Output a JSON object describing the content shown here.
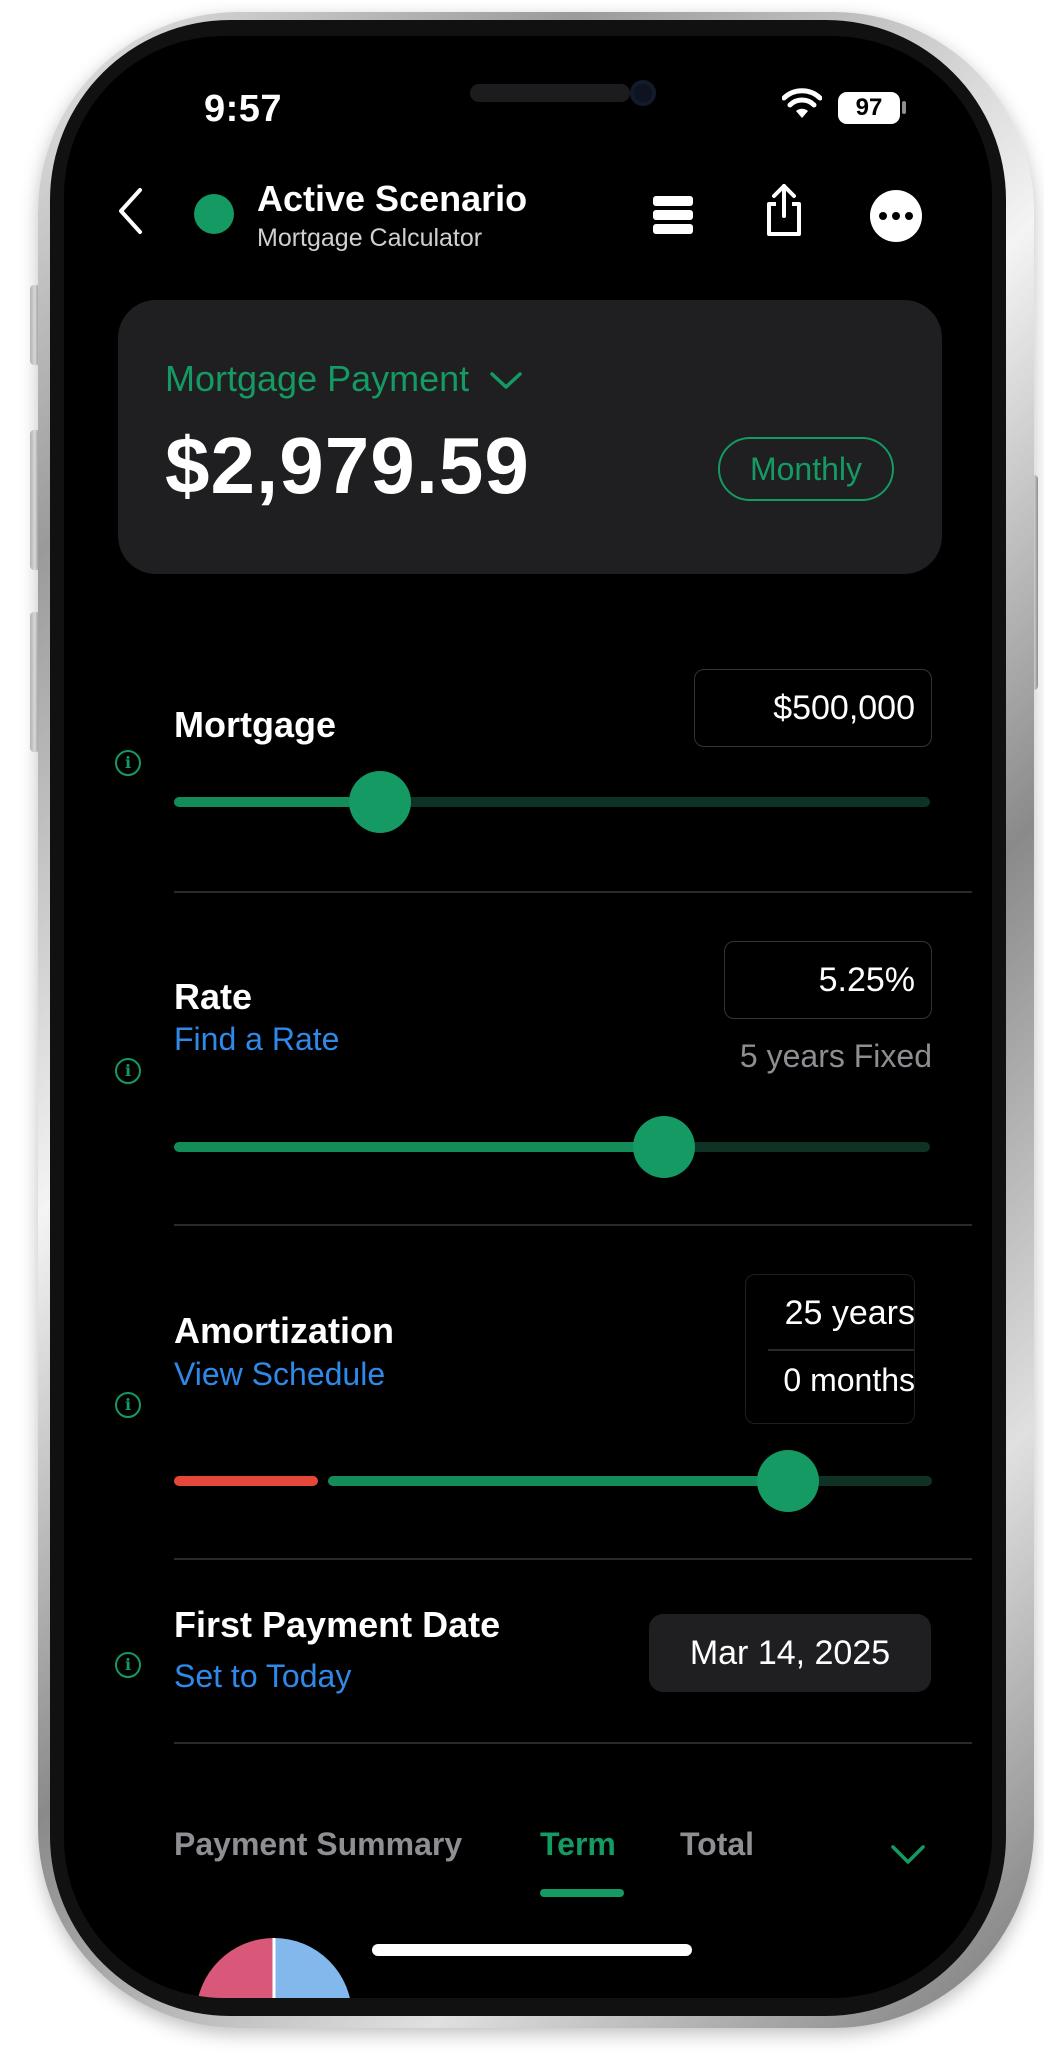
{
  "status_bar": {
    "time": "9:57",
    "battery": "97"
  },
  "nav": {
    "title": "Active Scenario",
    "subtitle": "Mortgage Calculator"
  },
  "payment_card": {
    "title": "Mortgage Payment",
    "amount": "$2,979.59",
    "frequency": "Monthly"
  },
  "mortgage": {
    "label": "Mortgage",
    "value": "$500,000",
    "slider_fraction": 0.27
  },
  "rate": {
    "label": "Rate",
    "link": "Find a Rate",
    "value": "5.25%",
    "term": "5 years Fixed",
    "slider_fraction": 0.65
  },
  "amortization": {
    "label": "Amortization",
    "link": "View Schedule",
    "years": "25 years",
    "months": "0 months",
    "slider_fraction": 0.81
  },
  "first_payment": {
    "label": "First Payment Date",
    "link": "Set to Today",
    "value": "Mar 14, 2025"
  },
  "summary_tabs": {
    "title": "Payment Summary",
    "tabs": [
      "Term",
      "Total"
    ],
    "active": "Term"
  },
  "colors": {
    "accent": "#149a62",
    "link": "#2e89e8",
    "warning": "#e5483a",
    "background": "#000000",
    "card": "#1f1f21"
  },
  "icons": [
    "back-chevron-icon",
    "status-dot-icon",
    "list-icon",
    "share-icon",
    "more-icon",
    "info-icon",
    "chevron-down-icon",
    "wifi-icon",
    "battery-icon"
  ]
}
